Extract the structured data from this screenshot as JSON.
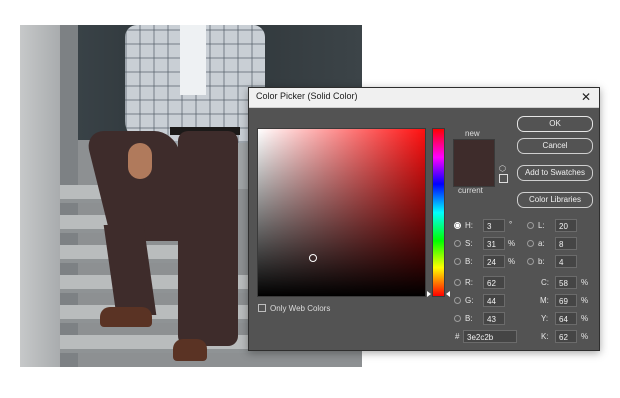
{
  "dialog": {
    "title": "Color Picker (Solid Color)",
    "close": "✕",
    "swatch": {
      "new_label": "new",
      "current_label": "current",
      "new_color": "#3e2c2b",
      "current_color": "#3e2c2b"
    },
    "buttons": {
      "ok": "OK",
      "cancel": "Cancel",
      "add_to_swatches": "Add to Swatches",
      "color_libraries": "Color Libraries"
    },
    "only_web_colors": "Only Web Colors",
    "hsb": [
      {
        "label": "H:",
        "value": "3",
        "unit": "°",
        "selected": true
      },
      {
        "label": "S:",
        "value": "31",
        "unit": "%",
        "selected": false
      },
      {
        "label": "B:",
        "value": "24",
        "unit": "%",
        "selected": false
      }
    ],
    "rgb": [
      {
        "label": "R:",
        "value": "62"
      },
      {
        "label": "G:",
        "value": "44"
      },
      {
        "label": "B:",
        "value": "43"
      }
    ],
    "lab": [
      {
        "label": "L:",
        "value": "20"
      },
      {
        "label": "a:",
        "value": "8"
      },
      {
        "label": "b:",
        "value": "4"
      }
    ],
    "cmyk": [
      {
        "label": "C:",
        "value": "58",
        "unit": "%"
      },
      {
        "label": "M:",
        "value": "69",
        "unit": "%"
      },
      {
        "label": "Y:",
        "value": "64",
        "unit": "%"
      },
      {
        "label": "K:",
        "value": "62",
        "unit": "%"
      }
    ],
    "hex_label": "#",
    "hex": "3e2c2b"
  },
  "colors": {
    "picked": "#3e2c2b"
  }
}
